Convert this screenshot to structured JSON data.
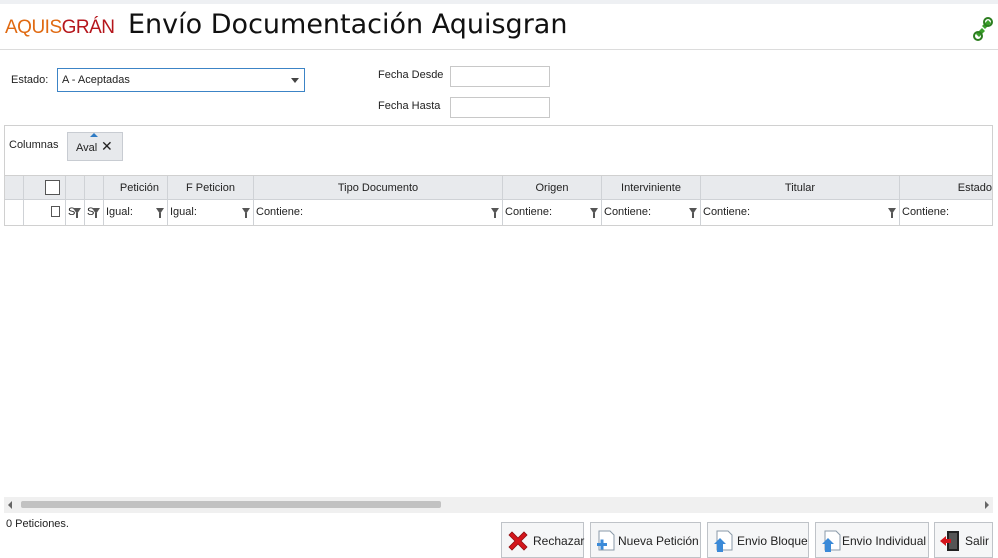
{
  "header": {
    "logo_part1": "AQUIS",
    "logo_part2": "GRÁN",
    "title": "Envío Documentación Aquisgran",
    "right_icon": "refresh-link-icon"
  },
  "filters": {
    "estado_label": "Estado:",
    "estado_value": "A - Aceptadas",
    "fecha_desde_label": "Fecha Desde",
    "fecha_desde_value": "",
    "fecha_hasta_label": "Fecha Hasta",
    "fecha_hasta_value": ""
  },
  "columns_panel": {
    "label": "Columnas",
    "chips": [
      "Aval"
    ]
  },
  "grid": {
    "headers": [
      "Petición",
      "F Peticion",
      "Tipo Documento",
      "Origen",
      "Interviniente",
      "Titular",
      "Estado"
    ],
    "filters": [
      "Igual:",
      "Igual:",
      "Contiene:",
      "Contiene:",
      "Contiene:",
      "Contiene:",
      "Contiene:"
    ],
    "small_filter_1": "S",
    "small_filter_2": "S",
    "rows": []
  },
  "status_text": "0 Peticiones.",
  "buttons": {
    "rechazar": "Rechazar",
    "nueva": "Nueva Petición",
    "envio_bloque": "Envio Bloque",
    "envio_individual": "Envio Individual",
    "salir": "Salir"
  },
  "colors": {
    "accent_blue": "#3c84c6",
    "logo_orange": "#e06a12",
    "logo_red": "#b5161c",
    "reject_red": "#d4161c"
  }
}
